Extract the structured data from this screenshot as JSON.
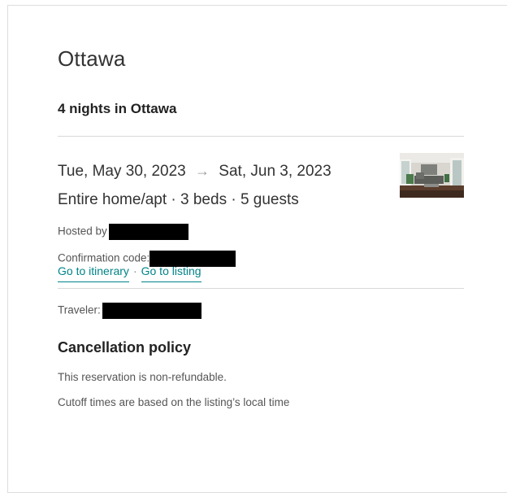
{
  "trip": {
    "city": "Ottawa",
    "nights_label": "4 nights in Ottawa",
    "checkin": "Tue, May 30, 2023",
    "arrow": "→",
    "checkout": "Sat, Jun 3, 2023",
    "listing_summary": "Entire home/apt · 3 beds · 5 guests"
  },
  "host": {
    "label": "Hosted by"
  },
  "confirmation": {
    "label": "Confirmation code:"
  },
  "links": {
    "itinerary": "Go to itinerary",
    "separator": "·",
    "listing": "Go to listing"
  },
  "traveler": {
    "label": "Traveler:"
  },
  "cancellation": {
    "title": "Cancellation policy",
    "line1": "This reservation is non-refundable.",
    "line2": "Cutoff times are based on the listing’s local time"
  },
  "colors": {
    "link": "#008489",
    "divider": "#d8d8d8",
    "redaction": "#000000"
  }
}
